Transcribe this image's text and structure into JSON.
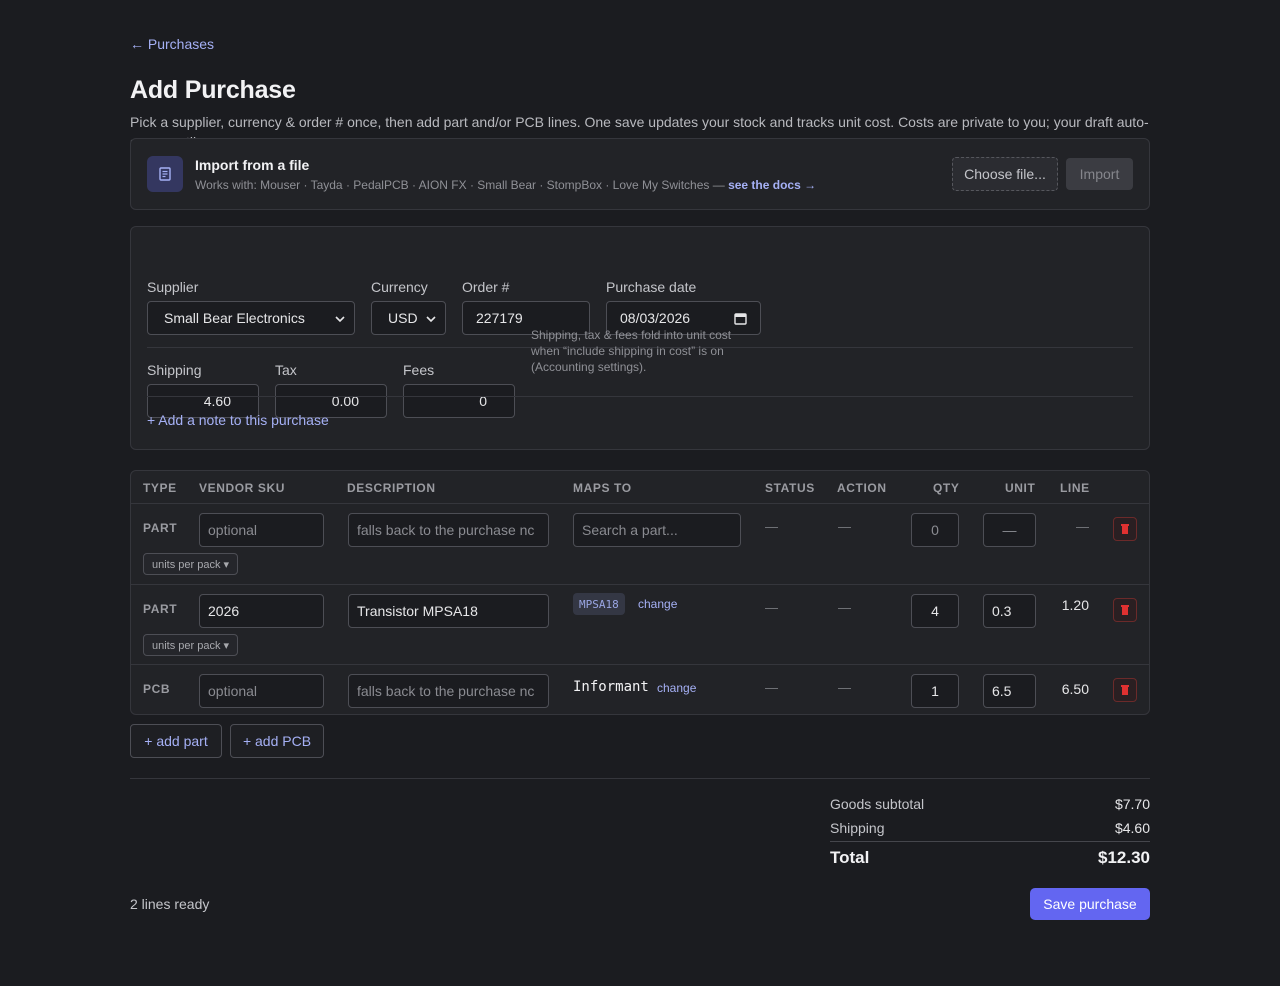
{
  "nav": {
    "back_label": "← Purchases"
  },
  "header": {
    "title": "Add Purchase",
    "subtitle": "Pick a supplier, currency & order # once, then add part and/or PCB lines. One save updates your stock and tracks unit cost. Costs are private to you; your draft auto-saves until you save."
  },
  "import": {
    "title": "Import from a file",
    "works_with": "Works with: Mouser · Tayda · PedalPCB · AION FX · Small Bear · StompBox · Love My Switches —",
    "docs_link": "see the docs →",
    "choose_label": "Choose file...",
    "import_label": "Import"
  },
  "form": {
    "supplier": {
      "label": "Supplier",
      "value": "Small Bear Electronics"
    },
    "currency": {
      "label": "Currency",
      "value": "USD"
    },
    "order": {
      "label": "Order #",
      "value": "227179"
    },
    "date": {
      "label": "Purchase date",
      "value": "08/03/2026"
    },
    "shipping": {
      "label": "Shipping",
      "value": "4.60"
    },
    "tax": {
      "label": "Tax",
      "value": "0.00"
    },
    "fees": {
      "label": "Fees",
      "value": "0"
    },
    "hint": "Shipping, tax & fees fold into unit cost when “include shipping in cost” is on (Accounting settings).",
    "note_link": "+ Add a note to this purchase"
  },
  "table": {
    "headers": {
      "type": "TYPE",
      "sku": "VENDOR SKU",
      "description": "DESCRIPTION",
      "maps_to": "MAPS TO",
      "status": "STATUS",
      "action": "ACTION",
      "qty": "QTY",
      "unit": "UNIT",
      "line": "LINE"
    },
    "rows": [
      {
        "type": "PART",
        "sku_placeholder": "optional",
        "desc_placeholder": "falls back to the purchase nc",
        "maps_placeholder": "Search a part...",
        "status": "—",
        "action": "—",
        "qty": "0",
        "unit": "—",
        "line": "—",
        "pack_label": "units per pack ▾"
      },
      {
        "type": "PART",
        "sku": "2026",
        "description": "Transistor MPSA18",
        "maps_badge": "MPSA18",
        "change_label": "change",
        "status": "—",
        "action": "—",
        "qty": "4",
        "unit": "0.3",
        "line": "1.20",
        "pack_label": "units per pack ▾"
      },
      {
        "type": "PCB",
        "sku_placeholder": "optional",
        "desc_placeholder": "falls back to the purchase nc",
        "maps_name": "Informant",
        "change_label": "change",
        "status": "—",
        "action": "—",
        "qty": "1",
        "unit": "6.5",
        "line": "6.50"
      }
    ]
  },
  "actions": {
    "add_part": "+ add part",
    "add_pcb": "+ add PCB",
    "save": "Save purchase"
  },
  "totals": {
    "subtotal_label": "Goods subtotal",
    "subtotal": "$7.70",
    "shipping_label": "Shipping",
    "shipping": "$4.60",
    "total_label": "Total",
    "total": "$12.30"
  },
  "footer": {
    "ready": "2 lines ready"
  },
  "colors": {
    "accent": "#6366f1",
    "link": "#a5b0f5",
    "danger": "#e03131",
    "background": "#1b1c20"
  }
}
